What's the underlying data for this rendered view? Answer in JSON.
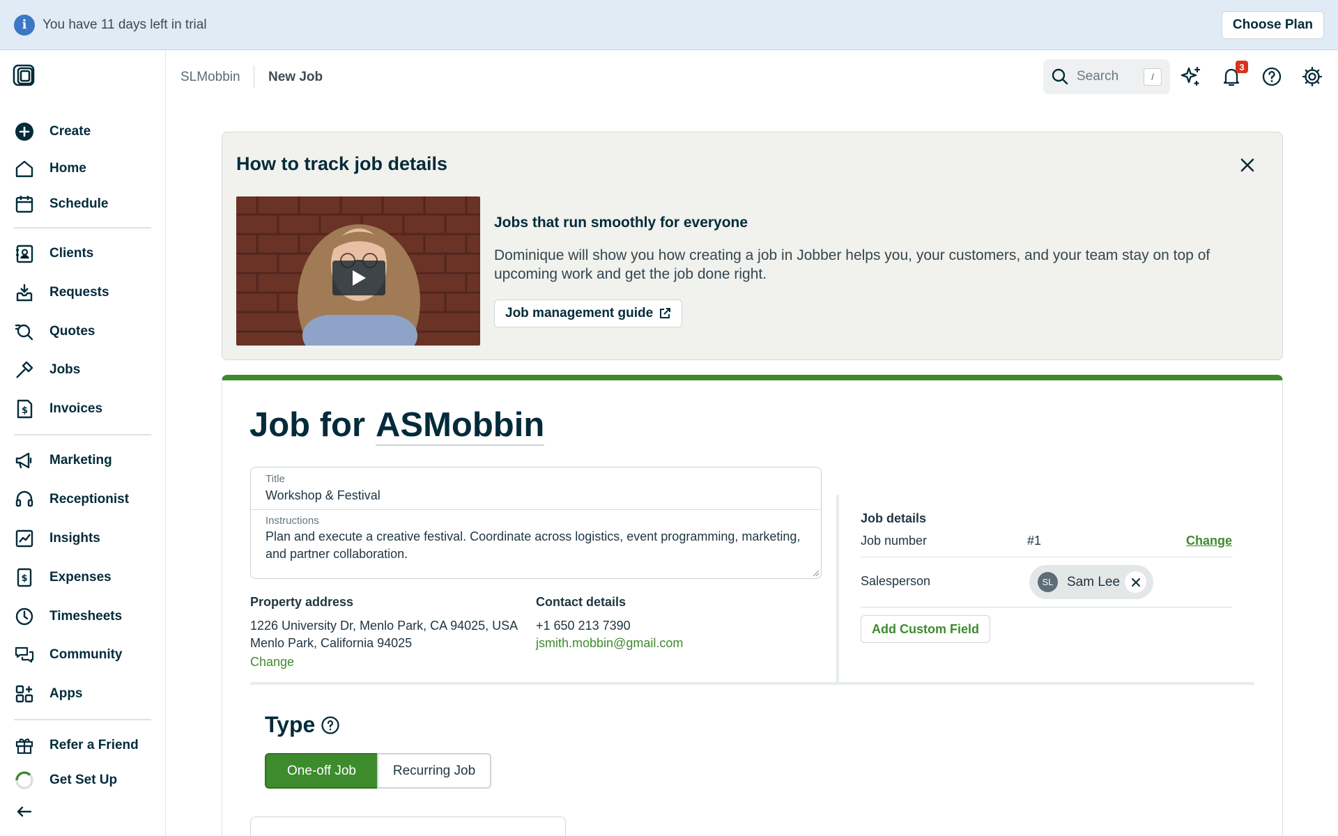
{
  "banner": {
    "text": "You have 11 days left in trial",
    "cta": "Choose Plan"
  },
  "sidebar": {
    "items": [
      {
        "label": "Create",
        "icon": "plus-circle-icon"
      },
      {
        "label": "Home",
        "icon": "home-icon"
      },
      {
        "label": "Schedule",
        "icon": "calendar-icon"
      },
      {
        "label": "Clients",
        "icon": "address-book-icon"
      },
      {
        "label": "Requests",
        "icon": "inbox-download-icon"
      },
      {
        "label": "Quotes",
        "icon": "quote-search-icon"
      },
      {
        "label": "Jobs",
        "icon": "hammer-icon"
      },
      {
        "label": "Invoices",
        "icon": "invoice-icon"
      },
      {
        "label": "Marketing",
        "icon": "megaphone-icon"
      },
      {
        "label": "Receptionist",
        "icon": "headset-icon"
      },
      {
        "label": "Insights",
        "icon": "chart-icon"
      },
      {
        "label": "Expenses",
        "icon": "receipt-icon"
      },
      {
        "label": "Timesheets",
        "icon": "clock-icon"
      },
      {
        "label": "Community",
        "icon": "chat-icon"
      },
      {
        "label": "Apps",
        "icon": "apps-grid-icon"
      },
      {
        "label": "Refer a Friend",
        "icon": "gift-icon"
      },
      {
        "label": "Get Set Up",
        "icon": "progress-ring-icon"
      }
    ]
  },
  "topbar": {
    "breadcrumb_account": "SLMobbin",
    "breadcrumb_page": "New Job",
    "search_placeholder": "Search",
    "search_shortcut": "/",
    "notifications_count": "3"
  },
  "info_card": {
    "title": "How to track job details",
    "heading": "Jobs that run smoothly for everyone",
    "body": "Dominique will show you how creating a job in Jobber helps you, your customers, and your team stay on top of upcoming work and get the job done right.",
    "guide_button": "Job management guide"
  },
  "job": {
    "title_prefix": "Job for",
    "client_name": "ASMobbin",
    "title_label": "Title",
    "title_value": "Workshop & Festival",
    "instructions_label": "Instructions",
    "instructions_value": "Plan and execute a creative festival. Coordinate across logistics, event programming, marketing, and partner collaboration.",
    "property_heading": "Property address",
    "property_line1": "1226 University Dr, Menlo Park, CA 94025, USA",
    "property_line2": "Menlo Park, California 94025",
    "property_change": "Change",
    "contact_heading": "Contact details",
    "contact_phone": "+1 650 213 7390",
    "contact_email": "jsmith.mobbin@gmail.com"
  },
  "job_details": {
    "heading": "Job details",
    "job_number_label": "Job number",
    "job_number_value": "#1",
    "change_link": "Change",
    "salesperson_label": "Salesperson",
    "salesperson_initials": "SL",
    "salesperson_name": "Sam Lee",
    "add_custom_field": "Add Custom Field"
  },
  "type_section": {
    "title": "Type",
    "options": [
      "One-off Job",
      "Recurring Job"
    ],
    "selected": "One-off Job"
  },
  "colors": {
    "brand_green": "#3d8b2d",
    "navy": "#032b3a",
    "banner_blue": "#e0ebf5",
    "badge_red": "#d6331f"
  }
}
